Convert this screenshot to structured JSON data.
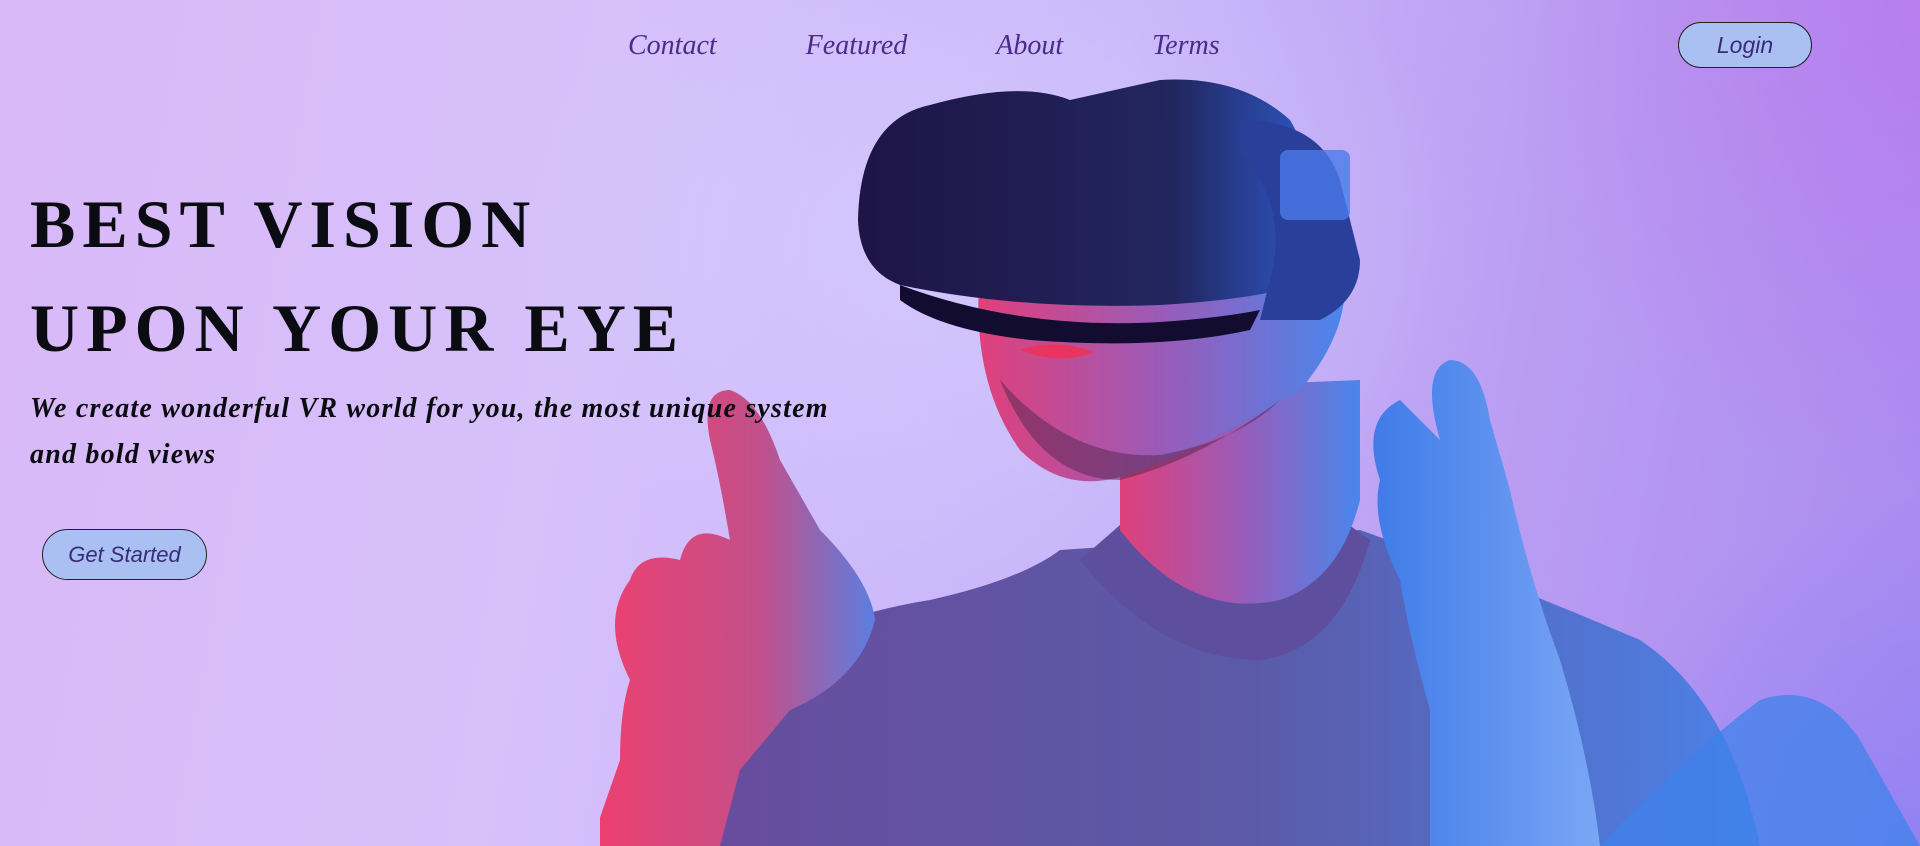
{
  "nav": {
    "items": [
      {
        "label": "Contact"
      },
      {
        "label": "Featured"
      },
      {
        "label": "About"
      },
      {
        "label": "Terms"
      }
    ],
    "login_label": "Login"
  },
  "hero": {
    "title_line1": "BEST VISION",
    "title_line2": "UPON YOUR EYE",
    "subtitle": "We create wonderful VR world for you, the most unique system and bold views",
    "cta_label": "Get Started"
  },
  "colors": {
    "button_fill": "#aac0f2",
    "nav_text": "#4b2a8a",
    "heading_text": "#0b0b12",
    "bg_left": "#d9b8f7",
    "bg_right": "#a98af0"
  }
}
